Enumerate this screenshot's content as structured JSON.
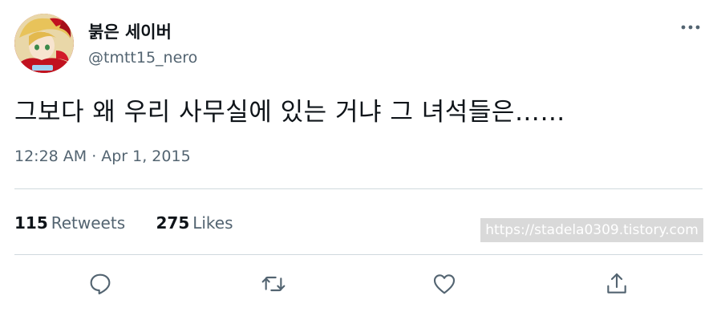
{
  "author": {
    "display_name": "붉은 세이버",
    "handle": "@tmtt15_nero"
  },
  "tweet": {
    "text": "그보다 왜 우리 사무실에 있는 거냐 그 녀석들은……",
    "time": "12:28 AM",
    "separator": "·",
    "date": "Apr 1, 2015"
  },
  "stats": {
    "retweets_count": "115",
    "retweets_label": "Retweets",
    "likes_count": "275",
    "likes_label": "Likes"
  },
  "watermark": {
    "text": "https://stadela0309.tistory.com"
  },
  "icons": {
    "more": "more-dots-icon",
    "reply": "reply-icon",
    "retweet": "retweet-icon",
    "like": "heart-icon",
    "share": "share-icon"
  },
  "colors": {
    "text_primary": "#0f1419",
    "text_secondary": "#536471",
    "divider": "#cfd9de",
    "icon": "#536471"
  }
}
